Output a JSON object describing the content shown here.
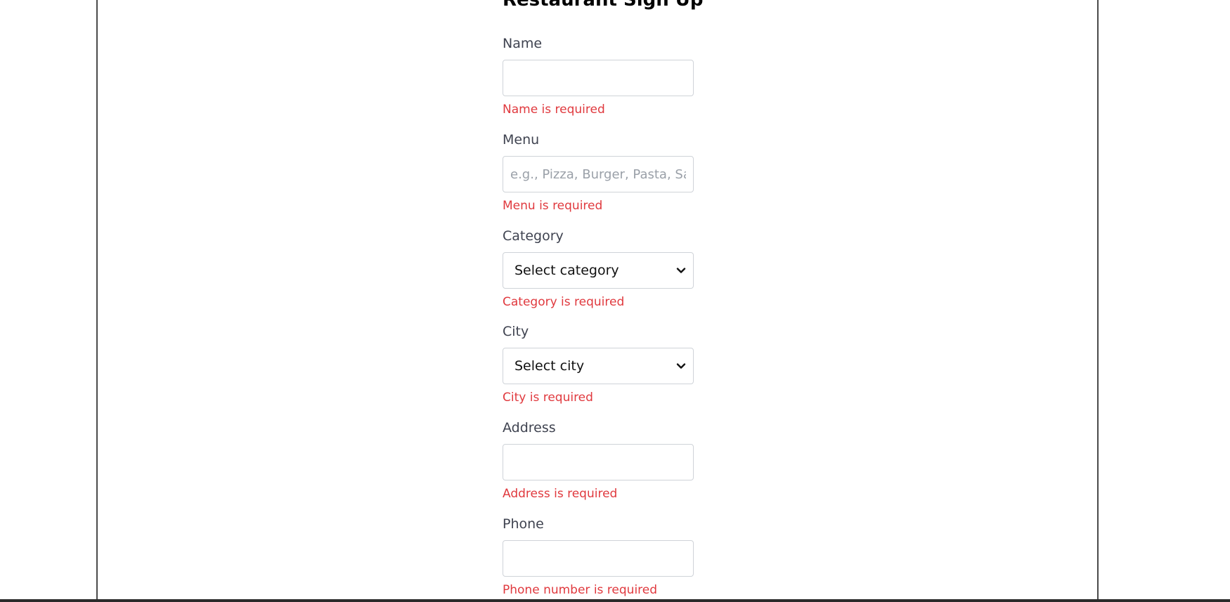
{
  "form": {
    "title": "Restaurant Sign Up",
    "fields": {
      "name": {
        "label": "Name",
        "value": "",
        "placeholder": "",
        "error": "Name is required"
      },
      "menu": {
        "label": "Menu",
        "value": "",
        "placeholder": "e.g., Pizza, Burger, Pasta, Salad",
        "error": "Menu is required"
      },
      "category": {
        "label": "Category",
        "selected": "Select category",
        "error": "Category is required"
      },
      "city": {
        "label": "City",
        "selected": "Select city",
        "error": "City is required"
      },
      "address": {
        "label": "Address",
        "value": "",
        "placeholder": "",
        "error": "Address is required"
      },
      "phone": {
        "label": "Phone",
        "value": "",
        "placeholder": "",
        "error": "Phone number is required"
      }
    }
  },
  "colors": {
    "error": "#e0393e",
    "label": "#3f4350",
    "input_border": "#cfd3d8",
    "frame_border": "#4a4a4a",
    "bottom_bar": "#2b2b2b"
  },
  "icons": {
    "select_arrow": "chevron-down-icon"
  }
}
